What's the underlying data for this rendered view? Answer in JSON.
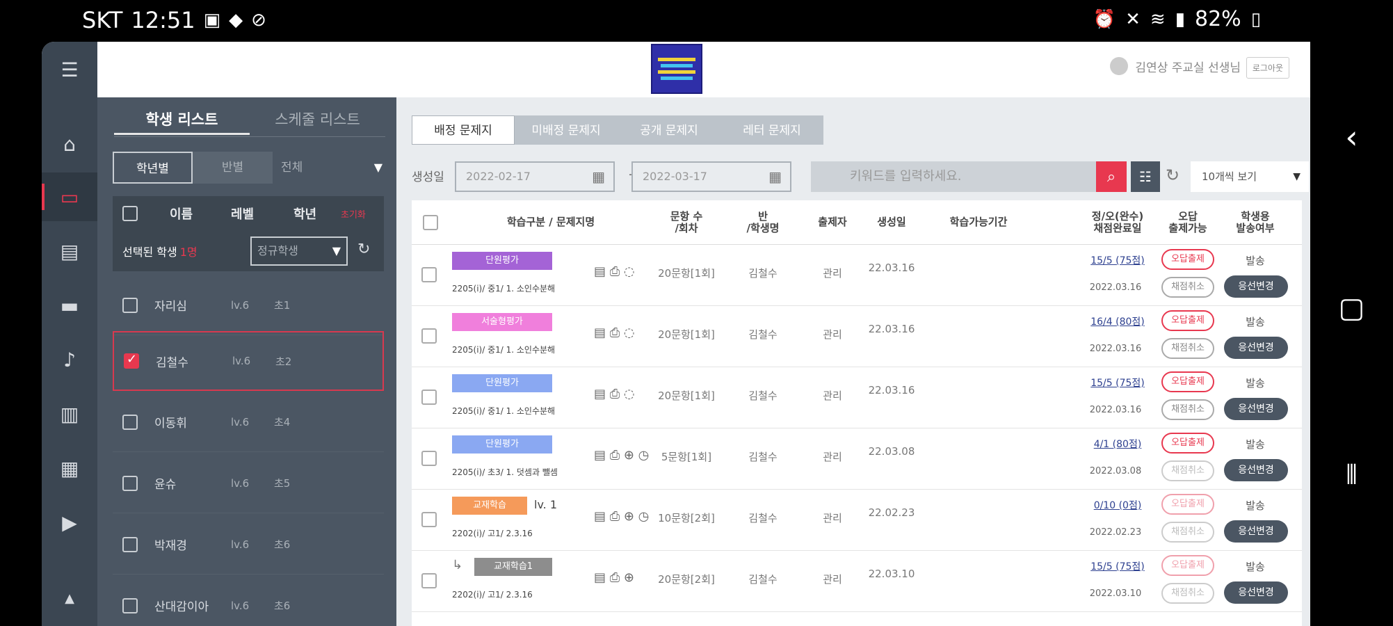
{
  "status_bar": {
    "carrier": "SKT",
    "time": "12:51",
    "battery": "82%"
  },
  "header": {
    "user_name": "김연상 주교실 선생님",
    "logout_label": "로그아웃"
  },
  "student_panel": {
    "tabs": [
      "학생 리스트",
      "스케줄 리스트"
    ],
    "segments": [
      "학년별",
      "반별"
    ],
    "segment_dropdown": "전체",
    "columns": [
      "이름",
      "레벨",
      "학년",
      "초기화"
    ],
    "selected_label": "선택된 학생",
    "selected_count": "1명",
    "student_type": "정규학생",
    "students": [
      {
        "name": "자리심",
        "level": "lv.6",
        "grade": "초1"
      },
      {
        "name": "김철수",
        "level": "lv.6",
        "grade": "초2"
      },
      {
        "name": "이동휘",
        "level": "lv.6",
        "grade": "초4"
      },
      {
        "name": "윤슈",
        "level": "lv.6",
        "grade": "초5"
      },
      {
        "name": "박재경",
        "level": "lv.6",
        "grade": "초6"
      },
      {
        "name": "산대감이아",
        "level": "lv.6",
        "grade": "초6"
      }
    ]
  },
  "content": {
    "tabs": [
      "배정 문제지",
      "미배정 문제지",
      "공개 문제지",
      "레터 문제지"
    ],
    "date_label": "생성일",
    "date_from": "2022-02-17",
    "date_to": "2022-03-17",
    "search_placeholder": "키워드를 입력하세요.",
    "per_page": "10개씩 보기",
    "columns": [
      "학습구분 / 문제지명",
      "문항 수\n/회차",
      "반\n/학생명",
      "출제자",
      "생성일",
      "학습가능기간",
      "정/오(완수)\n채점완료일",
      "오답\n출제가능",
      "학생용\n발송여부"
    ],
    "rows": [
      {
        "badge": "단원평가",
        "badge_color": "#a463d6",
        "level": "",
        "title": "2205(i)/ 중1/ 1. 소인수분해",
        "icons": "▤ ⎙ ◌",
        "items": "20문항[1회]",
        "student": "김철수",
        "author": "관리",
        "created": "22.03.16",
        "score": "15/5 (75점)",
        "graded": "2022.03.16",
        "wrong_label": "오답출제",
        "wrong_style": "red",
        "cancel_label": "채점취소",
        "cancel_style": "grey",
        "send": "발송",
        "change": "응선변경"
      },
      {
        "badge": "서술형평가",
        "badge_color": "#f07fdc",
        "level": "",
        "title": "2205(i)/ 중1/ 1. 소인수분해",
        "icons": "▤ ⎙ ◌",
        "items": "20문항[1회]",
        "student": "김철수",
        "author": "관리",
        "created": "22.03.16",
        "score": "16/4 (80점)",
        "graded": "2022.03.16",
        "wrong_label": "오답출제",
        "wrong_style": "red",
        "cancel_label": "채점취소",
        "cancel_style": "grey",
        "send": "발송",
        "change": "응선변경"
      },
      {
        "badge": "단원평가",
        "badge_color": "#8aa8f2",
        "level": "",
        "title": "2205(i)/ 중1/ 1. 소인수분해",
        "icons": "▤ ⎙ ◌",
        "items": "20문항[1회]",
        "student": "김철수",
        "author": "관리",
        "created": "22.03.16",
        "score": "15/5 (75점)",
        "graded": "2022.03.16",
        "wrong_label": "오답출제",
        "wrong_style": "red",
        "cancel_label": "채점취소",
        "cancel_style": "grey",
        "send": "발송",
        "change": "응선변경"
      },
      {
        "badge": "단원평가",
        "badge_color": "#8aa8f2",
        "level": "",
        "title": "2205(i)/ 초3/ 1. 덧셈과 뺄셈",
        "icons": "▤ ⎙ ⊕ ◷",
        "items": "5문항[1회]",
        "student": "김철수",
        "author": "관리",
        "created": "22.03.08",
        "score": "4/1 (80점)",
        "graded": "2022.03.08",
        "wrong_label": "오답출제",
        "wrong_style": "red",
        "cancel_label": "채점취소",
        "cancel_style": "greylight",
        "send": "발송",
        "change": "응선변경"
      },
      {
        "badge": "교재학습",
        "badge_color": "#f59a5a",
        "level": "lv. 1",
        "title": "2202(i)/ 고1/ 2.3.16",
        "icons": "▤ ⎙ ⊕ ◷",
        "items": "10문항[2회]",
        "student": "김철수",
        "author": "관리",
        "created": "22.02.23",
        "score": "0/10 (0점)",
        "graded": "2022.02.23",
        "wrong_label": "오답출제",
        "wrong_style": "redlight",
        "cancel_label": "채점취소",
        "cancel_style": "greylight",
        "send": "발송",
        "change": "응선변경"
      },
      {
        "badge": "교재학습1",
        "badge_color": "#8d8d8d",
        "level": "",
        "title": "2202(i)/ 고1/ 2.3.16",
        "icons": "▤ ⎙ ⊕",
        "items": "20문항[2회]",
        "student": "김철수",
        "author": "관리",
        "created": "22.03.10",
        "score": "15/5 (75점)",
        "graded": "2022.03.10",
        "wrong_label": "오답출제",
        "wrong_style": "redlight",
        "cancel_label": "채점취소",
        "cancel_style": "greylight",
        "send": "발송",
        "change": "응선변경",
        "sub": true
      }
    ]
  }
}
